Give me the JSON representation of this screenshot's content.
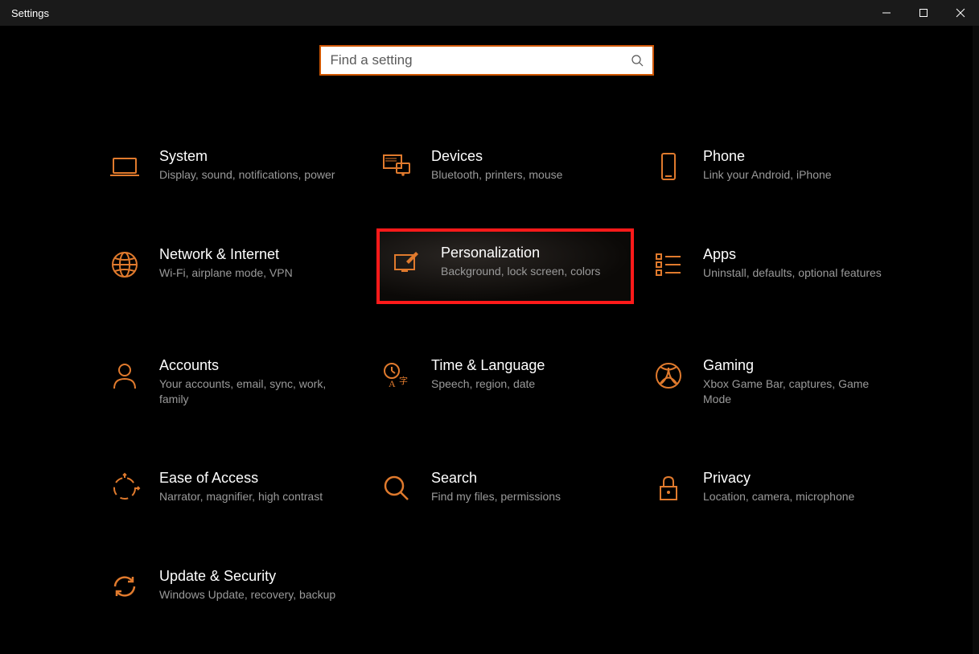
{
  "window": {
    "title": "Settings"
  },
  "search": {
    "placeholder": "Find a setting"
  },
  "accent": "#e07a2d",
  "categories": [
    {
      "id": "system",
      "title": "System",
      "desc": "Display, sound, notifications, power",
      "icon": "laptop"
    },
    {
      "id": "devices",
      "title": "Devices",
      "desc": "Bluetooth, printers, mouse",
      "icon": "devices"
    },
    {
      "id": "phone",
      "title": "Phone",
      "desc": "Link your Android, iPhone",
      "icon": "phone"
    },
    {
      "id": "network",
      "title": "Network & Internet",
      "desc": "Wi-Fi, airplane mode, VPN",
      "icon": "globe"
    },
    {
      "id": "personalization",
      "title": "Personalization",
      "desc": "Background, lock screen, colors",
      "icon": "personalize",
      "highlighted": true
    },
    {
      "id": "apps",
      "title": "Apps",
      "desc": "Uninstall, defaults, optional features",
      "icon": "apps-list"
    },
    {
      "id": "accounts",
      "title": "Accounts",
      "desc": "Your accounts, email, sync, work, family",
      "icon": "person"
    },
    {
      "id": "time-language",
      "title": "Time & Language",
      "desc": "Speech, region, date",
      "icon": "time-lang"
    },
    {
      "id": "gaming",
      "title": "Gaming",
      "desc": "Xbox Game Bar, captures, Game Mode",
      "icon": "xbox"
    },
    {
      "id": "ease-of-access",
      "title": "Ease of Access",
      "desc": "Narrator, magnifier, high contrast",
      "icon": "ease"
    },
    {
      "id": "search",
      "title": "Search",
      "desc": "Find my files, permissions",
      "icon": "search"
    },
    {
      "id": "privacy",
      "title": "Privacy",
      "desc": "Location, camera, microphone",
      "icon": "lock"
    },
    {
      "id": "update-security",
      "title": "Update & Security",
      "desc": "Windows Update, recovery, backup",
      "icon": "update"
    }
  ]
}
